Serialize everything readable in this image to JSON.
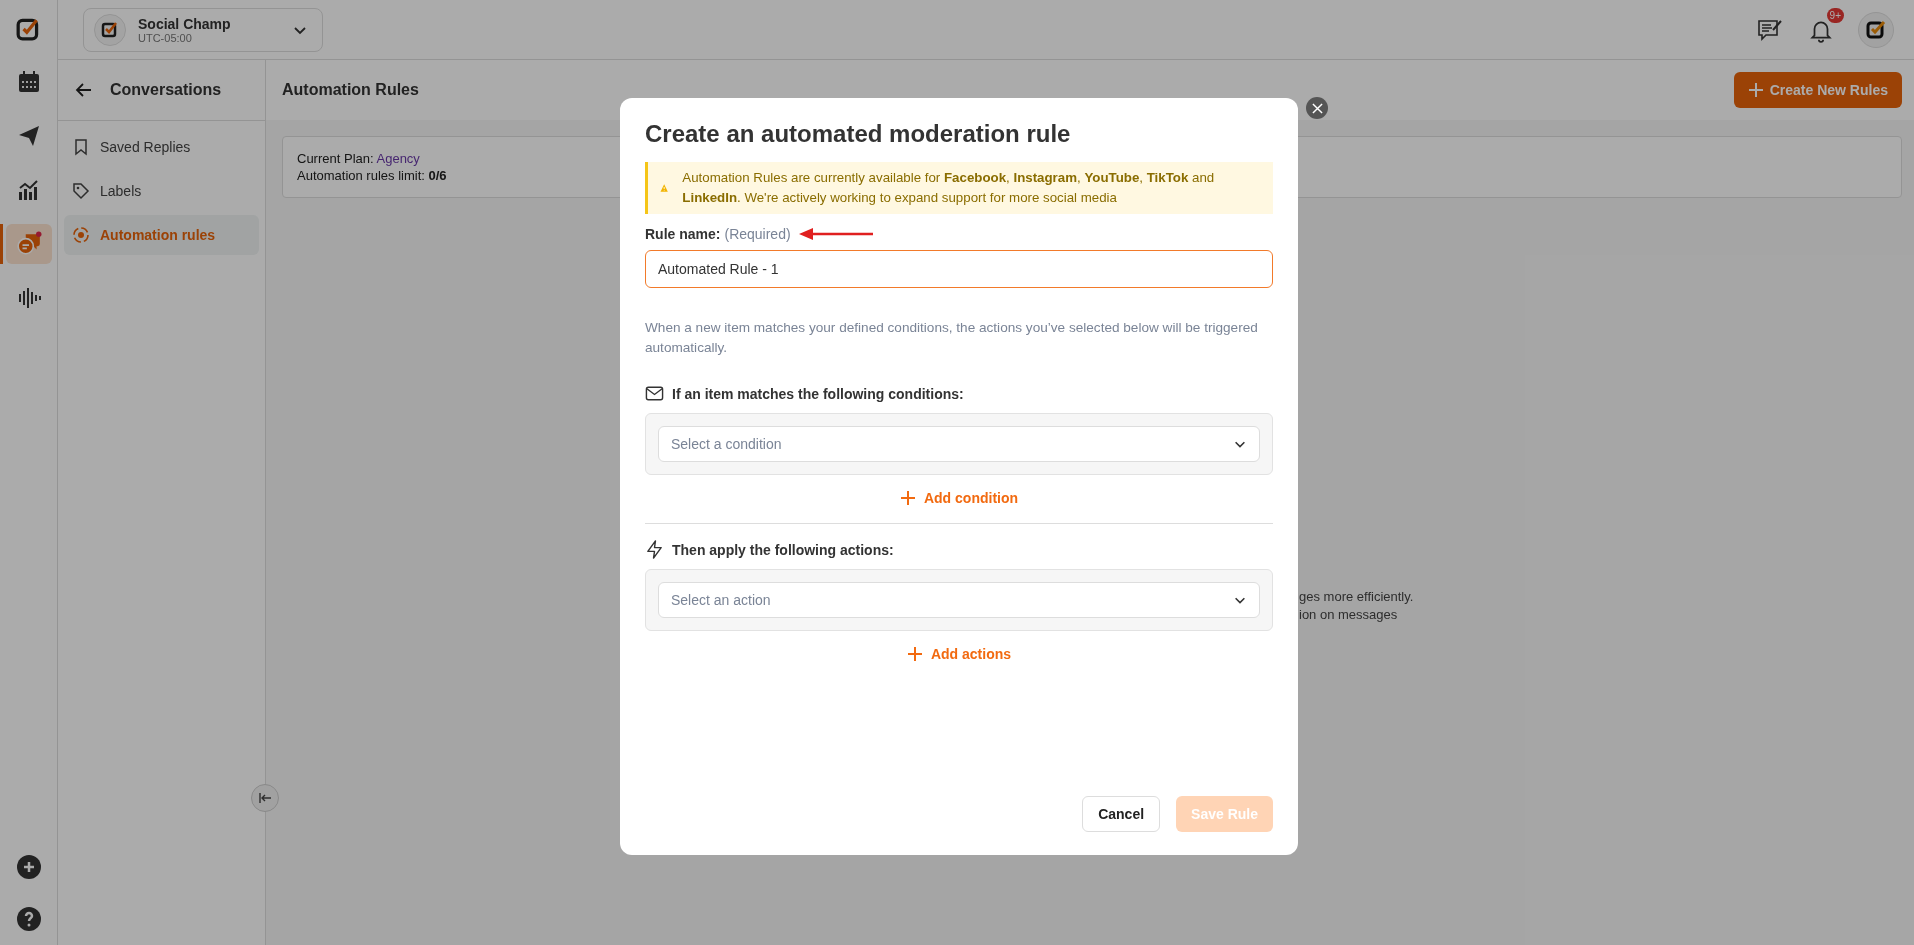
{
  "workspace": {
    "name": "Social Champ",
    "timezone": "UTC-05:00"
  },
  "rail_items": [
    {
      "kind": "calendar",
      "selected": false
    },
    {
      "kind": "send",
      "selected": false
    },
    {
      "kind": "chart",
      "selected": false
    },
    {
      "kind": "chat",
      "selected": true
    },
    {
      "kind": "wave",
      "selected": false
    }
  ],
  "top_bar": {
    "notification_count": "9+"
  },
  "sidebar": {
    "title": "Conversations",
    "items": [
      {
        "label": "Saved Replies",
        "kind": "bookmark",
        "selected": false
      },
      {
        "label": "Labels",
        "kind": "tag",
        "selected": false
      },
      {
        "label": "Automation rules",
        "kind": "automation",
        "selected": true
      }
    ]
  },
  "page": {
    "title": "Automation Rules",
    "create_button": "Create New Rules",
    "plan_label": "Current Plan:",
    "plan_name": "Agency",
    "limit": "Automation rules limit: **0/6**",
    "empty_text": [
      "ges more efficiently.",
      "ion on messages"
    ]
  },
  "modal": {
    "title": "Create an automated moderation rule",
    "notice": "Automation Rules are currently available for **Facebook**, **Instagram**, **YouTube**, **TikTok** and **LinkedIn**. We're actively working to expand support for more social media",
    "rule_label": "Rule name:",
    "rule_hint": "(Required)",
    "rule_value": "Automated Rule - 1",
    "description": "When a new item matches your defined conditions, the actions you’ve selected below will be triggered automatically.",
    "conditions_heading": "If an item matches the following conditions:",
    "condition_placeholder": "Select a condition",
    "add_condition": "Add condition",
    "actions_heading": "Then apply the following actions:",
    "action_placeholder": "Select an action",
    "add_actions": "Add actions",
    "cancel": "Cancel",
    "save": {
      "label": "Save Rule",
      "disabled": true
    }
  }
}
